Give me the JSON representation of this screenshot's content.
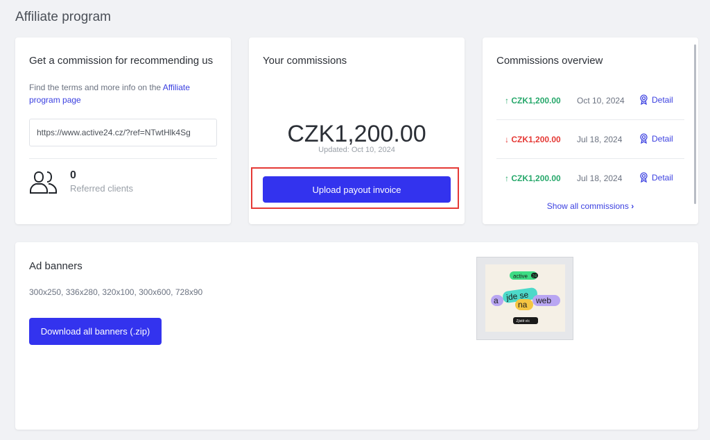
{
  "page": {
    "title": "Affiliate program"
  },
  "recommend": {
    "title": "Get a commission for recommending us",
    "terms_prefix": "Find the terms and more info on the ",
    "terms_link": "Affiliate program page",
    "ref_url": "https://www.active24.cz/?ref=NTwtHlk4Sg",
    "referred_count": "0",
    "referred_label": "Referred clients",
    "icon": "users-icon"
  },
  "commissions": {
    "title": "Your commissions",
    "amount": "CZK1,200.00",
    "updated": "Updated: Oct 10, 2024",
    "upload_button": "Upload payout invoice"
  },
  "overview": {
    "title": "Commissions overview",
    "rows": [
      {
        "direction": "up",
        "arrow": "↑",
        "amount": "CZK1,200.00",
        "date": "Oct 10, 2024",
        "detail": "Detail",
        "color": "#27a86b"
      },
      {
        "direction": "down",
        "arrow": "↓",
        "amount": "CZK1,200.00",
        "date": "Jul 18, 2024",
        "detail": "Detail",
        "color": "#e53935"
      },
      {
        "direction": "up",
        "arrow": "↑",
        "amount": "CZK1,200.00",
        "date": "Jul 18, 2024",
        "detail": "Detail",
        "color": "#27a86b"
      }
    ],
    "show_all": "Show all commissions",
    "show_all_chevron": "›"
  },
  "banners": {
    "title": "Ad banners",
    "sizes": "300x250, 336x280, 320x100, 300x600, 728x90",
    "download_button": "Download all banners (.zip)",
    "thumb": {
      "brand": "active",
      "brand_num": "24",
      "word_a": "a",
      "word_jde": "jde se",
      "word_na": "na",
      "word_web": "web",
      "cta": "Zjistit víc"
    }
  },
  "colors": {
    "primary": "#3333ee",
    "link": "#3a3fe0",
    "positive": "#27a86b",
    "negative": "#e53935",
    "highlight": "#e53935"
  }
}
